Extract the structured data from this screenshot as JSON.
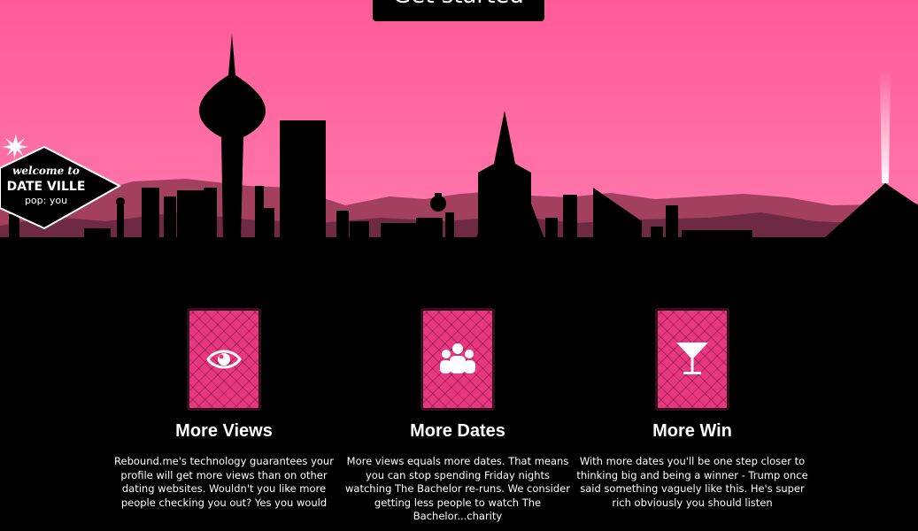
{
  "hero": {
    "cta_label": "Get started",
    "sign": {
      "line1": "welcome to",
      "line2": "DATE VILLE",
      "line3": "pop: you"
    }
  },
  "features": [
    {
      "icon": "eye-icon",
      "title": "More Views",
      "description": "Rebound.me's technology guarantees your profile will get more views than on other dating websites. Wouldn't you like more people checking you out? Yes you would"
    },
    {
      "icon": "group-icon",
      "title": "More Dates",
      "description": "More views equals more dates. That means you can stop spending Friday nights watching The Bachelor re-runs. We consider getting less people to watch The Bachelor...charity"
    },
    {
      "icon": "martini-icon",
      "title": "More Win",
      "description": "With more dates you'll be one step closer to thinking big and being a winner - Trump once said something vaguely like this. He's super rich obviously you should listen"
    }
  ],
  "colors": {
    "sky_top": "#ff5a98",
    "card_pink": "#e8367f",
    "mountain": "#a3405f"
  }
}
